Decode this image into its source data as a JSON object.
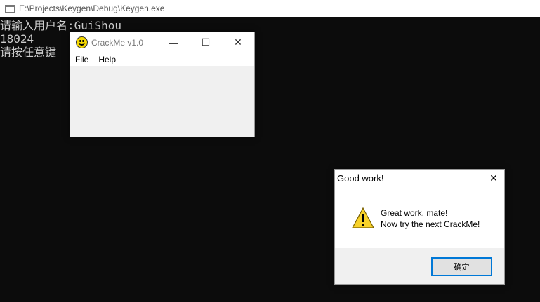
{
  "console": {
    "title": "E:\\Projects\\Keygen\\Debug\\Keygen.exe",
    "lines": [
      "请输入用户名:GuiShou",
      "18024",
      "请按任意键"
    ]
  },
  "crackme": {
    "title": "CrackMe v1.0",
    "menu": [
      "File",
      "Help"
    ],
    "controls": {
      "minimize": "—",
      "maximize": "☐",
      "close": "✕"
    }
  },
  "msgbox": {
    "title": "Good work!",
    "close": "✕",
    "line1": "Great work, mate!",
    "line2": "Now try the next CrackMe!",
    "ok_label": "确定"
  },
  "colors": {
    "console_bg": "#0c0c0c",
    "console_text": "#cccccc",
    "focus_border": "#0078d7"
  }
}
